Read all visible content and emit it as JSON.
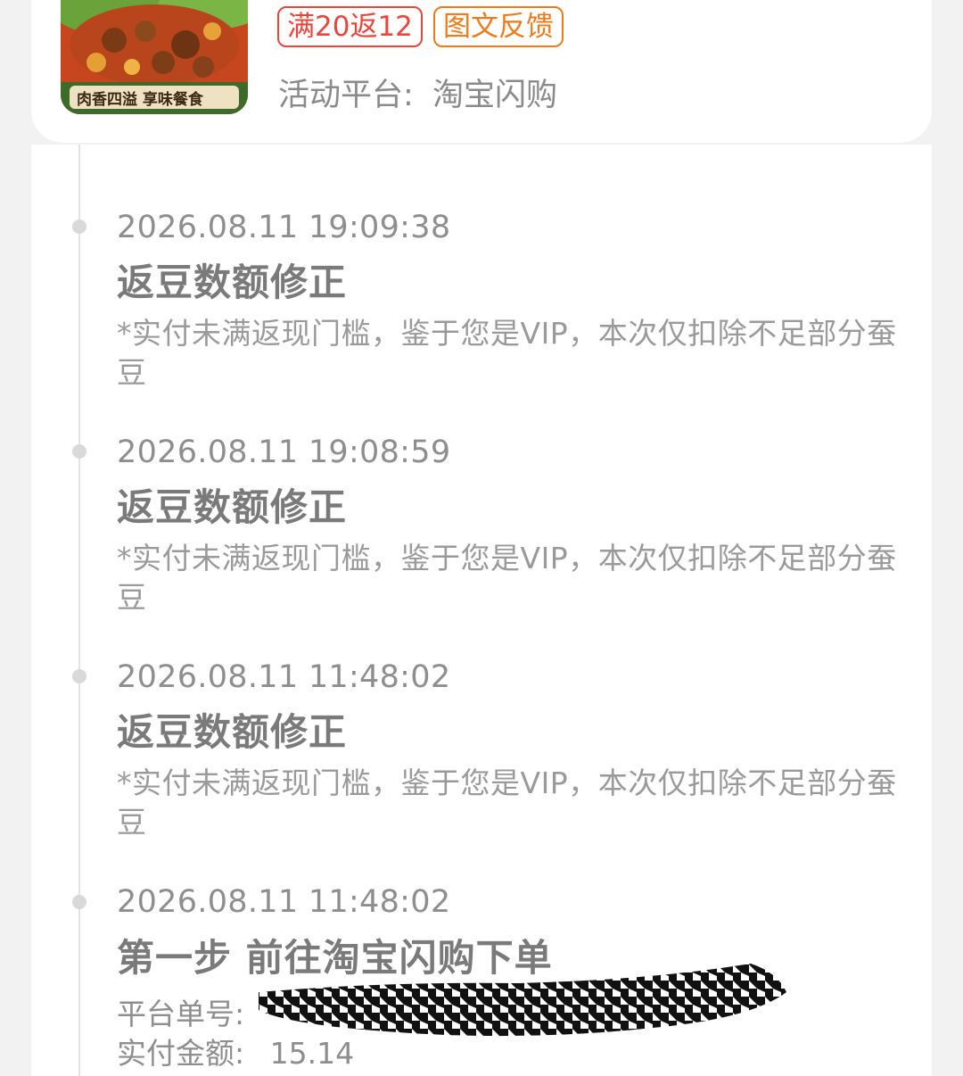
{
  "product": {
    "thumbnail_caption": "肉香四溢 享味餐食",
    "tags": [
      "满20返12",
      "图文反馈"
    ],
    "platform_label": "活动平台:",
    "platform_name": "淘宝闪购"
  },
  "timeline": [
    {
      "timestamp": "2026.08.11 19:09:38",
      "title": "返豆数额修正",
      "desc": "*实付未满返现门槛，鉴于您是VIP，本次仅扣除不足部分蚕豆"
    },
    {
      "timestamp": "2026.08.11 19:08:59",
      "title": "返豆数额修正",
      "desc": "*实付未满返现门槛，鉴于您是VIP，本次仅扣除不足部分蚕豆"
    },
    {
      "timestamp": "2026.08.11 11:48:02",
      "title": "返豆数额修正",
      "desc": "*实付未满返现门槛，鉴于您是VIP，本次仅扣除不足部分蚕豆"
    },
    {
      "timestamp": "2026.08.11 11:48:02",
      "title": "第一步 前往淘宝闪购下单",
      "order_label": "平台单号:",
      "amount_label": "实付金额:",
      "amount_value": "15.14"
    }
  ],
  "colors": {
    "offer_tag": "#e8453c",
    "feedback_tag": "#f07a1a",
    "timeline_dot": "#d9d9d9"
  }
}
